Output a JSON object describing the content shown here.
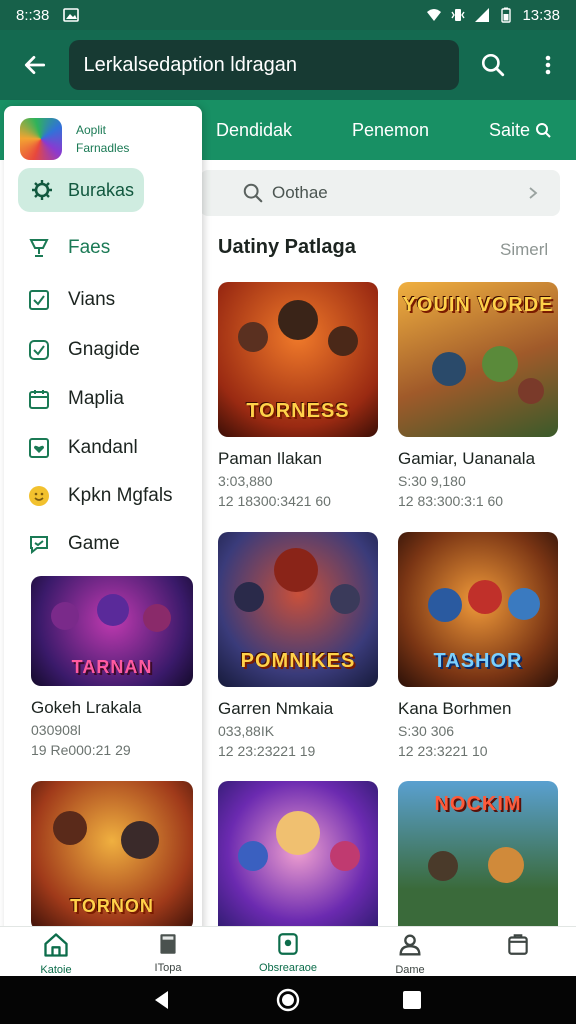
{
  "status": {
    "time_left": "8::38",
    "time_right": "13:38"
  },
  "app_bar": {
    "title": "Lerkalsedaption ldragan"
  },
  "tabs": [
    {
      "label": "Dendidak"
    },
    {
      "label": "Penemon"
    },
    {
      "label": "Saite"
    }
  ],
  "search": {
    "placeholder": "Oothae"
  },
  "section": {
    "title": "Uatiny Patlaga",
    "more": "Simerl"
  },
  "cards": [
    {
      "name": "Paman Ilakan",
      "meta1": "3:03,880",
      "meta2": "12 18300:3421 60",
      "logo": "TORNESS",
      "bg": "#9a2a12"
    },
    {
      "name": "Gamiar, Uananala",
      "meta1": "S:30 9,180",
      "meta2": "12 83:300:3:1 60",
      "logo": "YOUIN VORDE",
      "bg": "#7a4a2a"
    },
    {
      "name": "Garren Nmkaia",
      "meta1": "033,88IK",
      "meta2": "12 23:23221 19",
      "logo": "POMNIKES",
      "bg": "#3a3b7a"
    },
    {
      "name": "Kana Borhmen",
      "meta1": "S:30 306",
      "meta2": "12 23:3221 10",
      "logo": "TASHOR",
      "bg": "#7a3514"
    },
    {
      "name": "",
      "meta1": "",
      "meta2": "",
      "logo": "",
      "bg": "#6b2ab0"
    },
    {
      "name": "",
      "meta1": "",
      "meta2": "",
      "logo": "NOCKIM",
      "bg": "#3a6a3a"
    }
  ],
  "drawer": {
    "app_name_1": "Aoplit",
    "app_name_2": "Farnadles",
    "active_label": "Burakas",
    "items": [
      {
        "label": "Faes",
        "icon": "trophy-icon"
      },
      {
        "label": "Vians",
        "icon": "checkbox-icon"
      },
      {
        "label": "Gnagide",
        "icon": "shield-icon"
      },
      {
        "label": "Maplia",
        "icon": "calendar-icon"
      },
      {
        "label": "Kandanl",
        "icon": "heart-box-icon"
      },
      {
        "label": "Kpkn Mgfals",
        "icon": "smiley-icon"
      },
      {
        "label": "Game",
        "icon": "chat-bubble-icon"
      }
    ],
    "promo": {
      "name": "Gokeh Lrakala",
      "meta1": "030908l",
      "meta2": "19 Re000:21 29",
      "logo": "TARNAN"
    }
  },
  "bottom_nav": [
    {
      "label": "Katoie"
    },
    {
      "label": "ITopa"
    },
    {
      "label": "Obsrearaoe"
    },
    {
      "label": "Dame"
    },
    {
      "label": ""
    }
  ],
  "colors": {
    "primary": "#146a50",
    "tab_strip": "#189064",
    "accent": "#1b7a55"
  }
}
